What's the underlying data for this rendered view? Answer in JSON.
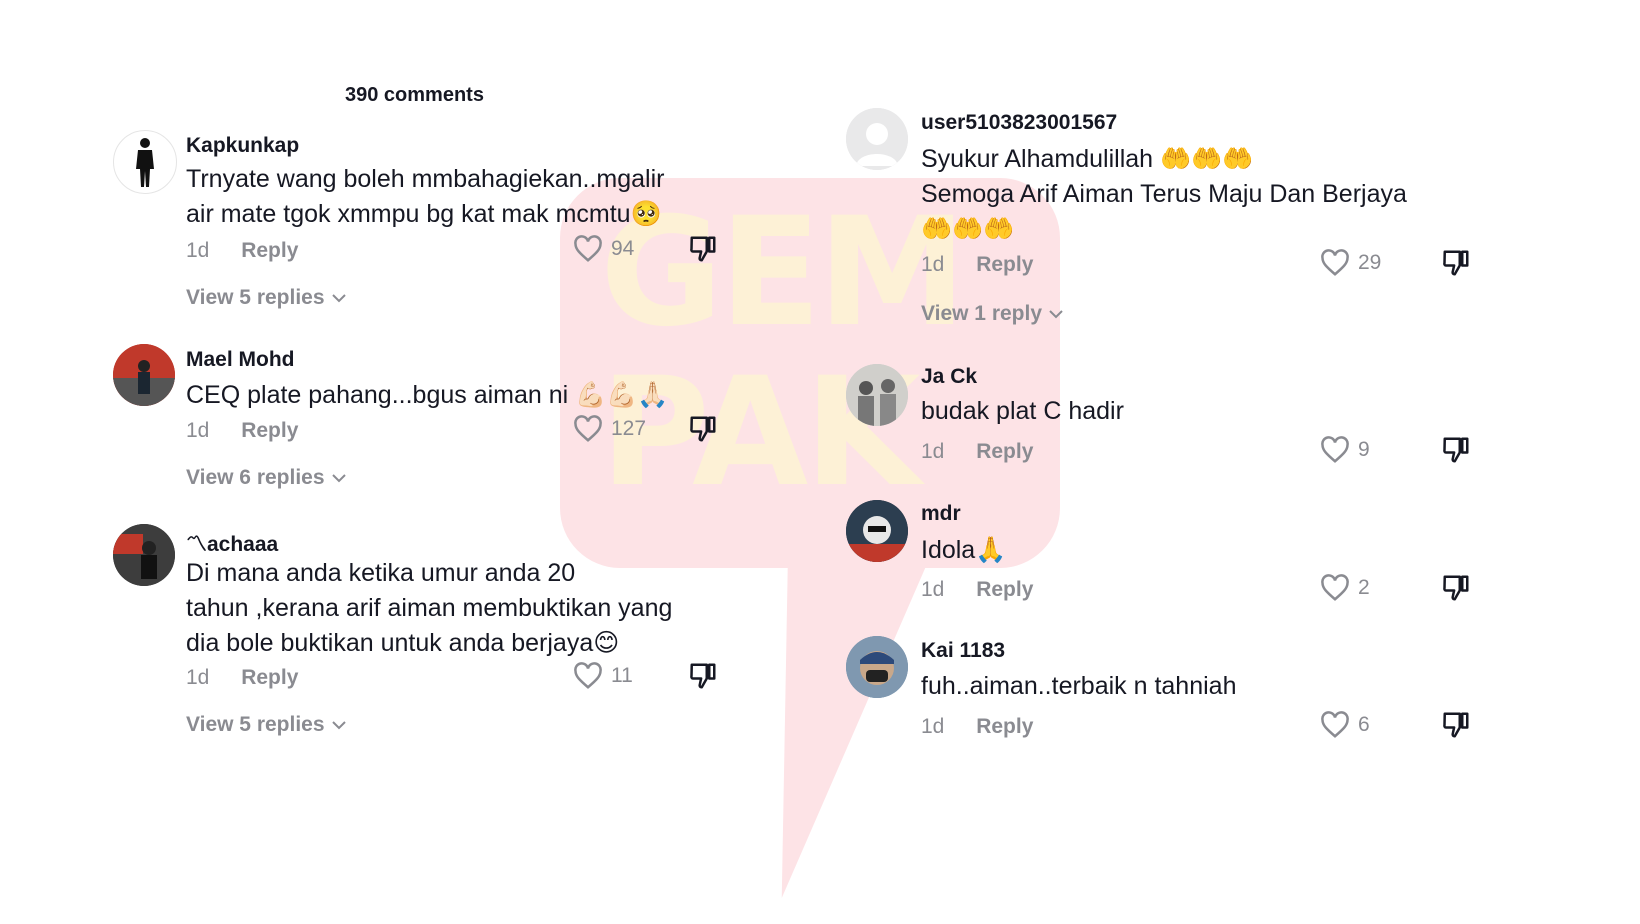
{
  "header": {
    "count_label": "390 comments"
  },
  "left": [
    {
      "username": "Kapkunkap",
      "text_line1": "Trnyate wang boleh mmbahagiekan..mgalir",
      "text_line2": "air mate tgok xmmpu bg kat mak mcmtu🥺",
      "time": "1d",
      "reply": "Reply",
      "likes": "94",
      "view_replies": "View 5 replies"
    },
    {
      "username": "Mael Mohd",
      "text_line1": "CEQ plate pahang...bgus aiman ni 💪🏻💪🏻🙏🏻",
      "time": "1d",
      "reply": "Reply",
      "likes": "127",
      "view_replies": "View 6 replies"
    },
    {
      "username": "〽achaaa",
      "text_line1": "Di mana anda ketika umur anda 20",
      "text_line2": "tahun ,kerana arif aiman membuktikan yang",
      "text_line3": "dia bole buktikan untuk anda berjaya😊",
      "time": "1d",
      "reply": "Reply",
      "likes": "11",
      "view_replies": "View 5 replies"
    }
  ],
  "right": [
    {
      "username": "user5103823001567",
      "text_line1": "Syukur Alhamdulillah 🤲🤲🤲",
      "text_line2": "Semoga Arif Aiman Terus Maju Dan Berjaya",
      "text_line3": "🤲🤲🤲",
      "time": "1d",
      "reply": "Reply",
      "likes": "29",
      "view_replies": "View 1 reply"
    },
    {
      "username": "Ja Ck",
      "text_line1": "budak plat C hadir",
      "time": "1d",
      "reply": "Reply",
      "likes": "9"
    },
    {
      "username": "mdr",
      "text_line1": "Idola🙏",
      "time": "1d",
      "reply": "Reply",
      "likes": "2"
    },
    {
      "username": "Kai 1183",
      "text_line1": "fuh..aiman..terbaik n tahniah",
      "time": "1d",
      "reply": "Reply",
      "likes": "6"
    }
  ],
  "watermark": {
    "line1": "GEM",
    "line2": "PAK"
  },
  "icons": [
    "heart-icon",
    "dislike-icon",
    "chevron-down-icon"
  ],
  "colors": {
    "text": "#161823",
    "muted": "#8a8b91",
    "watermark": "#fde3e6"
  }
}
